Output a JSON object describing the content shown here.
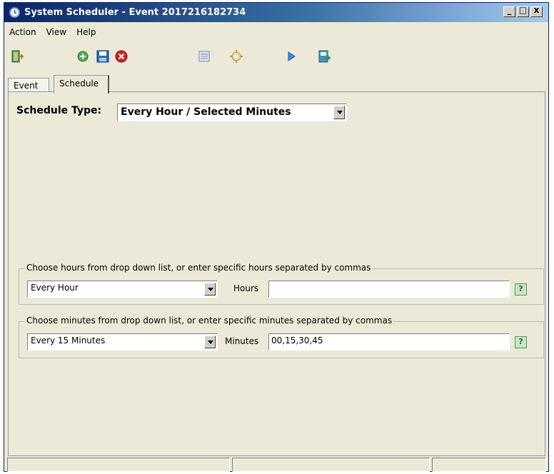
{
  "window": {
    "title": "System Scheduler - Event 2017216182734"
  },
  "title_buttons": {
    "minimize": "_",
    "maximize": "□",
    "close": "x"
  },
  "menu": [
    {
      "label": "Action"
    },
    {
      "label": "View"
    },
    {
      "label": "Help"
    }
  ],
  "toolbar": {
    "icons": [
      "exit-icon",
      "add-icon",
      "save-icon",
      "delete-icon",
      "list-icon",
      "settings-icon",
      "run-icon",
      "export-icon"
    ]
  },
  "tabs": [
    {
      "label": "Event"
    },
    {
      "label": "Schedule"
    }
  ],
  "schedule": {
    "type_label": "Schedule Type:",
    "type_value": "Every Hour / Selected Minutes"
  },
  "hours_group": {
    "title": "Choose hours from drop down list, or enter specific hours separated by commas",
    "dropdown_value": "Every Hour",
    "field_label": "Hours",
    "field_value": ""
  },
  "minutes_group": {
    "title": "Choose minutes from drop down list, or enter specific minutes separated by commas",
    "dropdown_value": "Every 15 Minutes",
    "field_label": "Minutes",
    "field_value": "00,15,30,45"
  },
  "help_glyph": "?",
  "status_panels": [
    "",
    "",
    ""
  ],
  "colors": {
    "title_start": "#0a246a",
    "title_end": "#a6caf0",
    "face": "#ece9d8"
  }
}
